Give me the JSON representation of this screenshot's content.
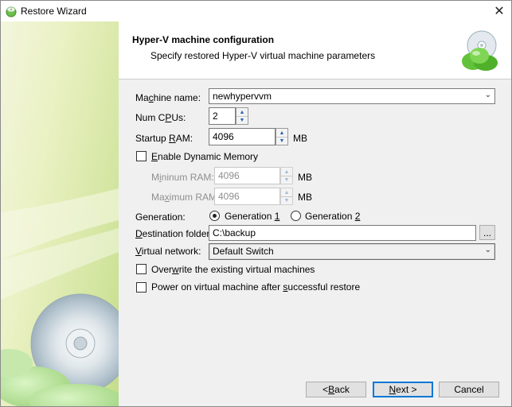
{
  "window": {
    "title": "Restore Wizard",
    "close_glyph": "✕"
  },
  "header": {
    "title": "Hyper-V machine configuration",
    "subtitle": "Specify restored Hyper-V virtual machine parameters",
    "icon": "disc-cloud-icon"
  },
  "form": {
    "machine_name": {
      "label_pre": "Ma",
      "label_u": "c",
      "label_post": "hine name:",
      "value": "newhypervvm"
    },
    "num_cpus": {
      "label_pre": "Num C",
      "label_u": "P",
      "label_post": "Us:",
      "value": "2"
    },
    "startup_ram": {
      "label_pre": "Startup ",
      "label_u": "R",
      "label_post": "AM:",
      "value": "4096",
      "unit": "MB"
    },
    "dynamic_memory": {
      "label_pre": "",
      "label_u": "E",
      "label_post": "nable Dynamic Memory",
      "checked": false
    },
    "minimum_ram": {
      "label_pre": "M",
      "label_u": "i",
      "label_post": "ninum RAM:",
      "value": "4096",
      "unit": "MB"
    },
    "maximum_ram": {
      "label_pre": "Ma",
      "label_u": "x",
      "label_post": "imum RAM:",
      "value": "4096",
      "unit": "MB"
    },
    "generation": {
      "label": "Generation:",
      "option1_pre": "Generation ",
      "option1_u": "1",
      "option2_pre": "Generation ",
      "option2_u": "2",
      "selected": "Generation 1"
    },
    "destination_folder": {
      "label_pre": "",
      "label_u": "D",
      "label_post": "estination folder:",
      "value": "C:\\backup",
      "browse_label": "..."
    },
    "virtual_network": {
      "label_pre": "",
      "label_u": "V",
      "label_post": "irtual network:",
      "value": "Default Switch"
    },
    "overwrite": {
      "label_pre": "Over",
      "label_u": "w",
      "label_post": "rite the existing virtual machines",
      "checked": false
    },
    "power_on": {
      "label_pre": "Power on virtual machine after ",
      "label_u": "s",
      "label_post": "uccessful restore",
      "checked": false
    }
  },
  "buttons": {
    "back_pre": "< ",
    "back_u": "B",
    "back_post": "ack",
    "next_u": "N",
    "next_post": "ext >",
    "cancel": "Cancel"
  },
  "colors": {
    "accent": "#0078d7",
    "banner": "#d4e6a2"
  }
}
